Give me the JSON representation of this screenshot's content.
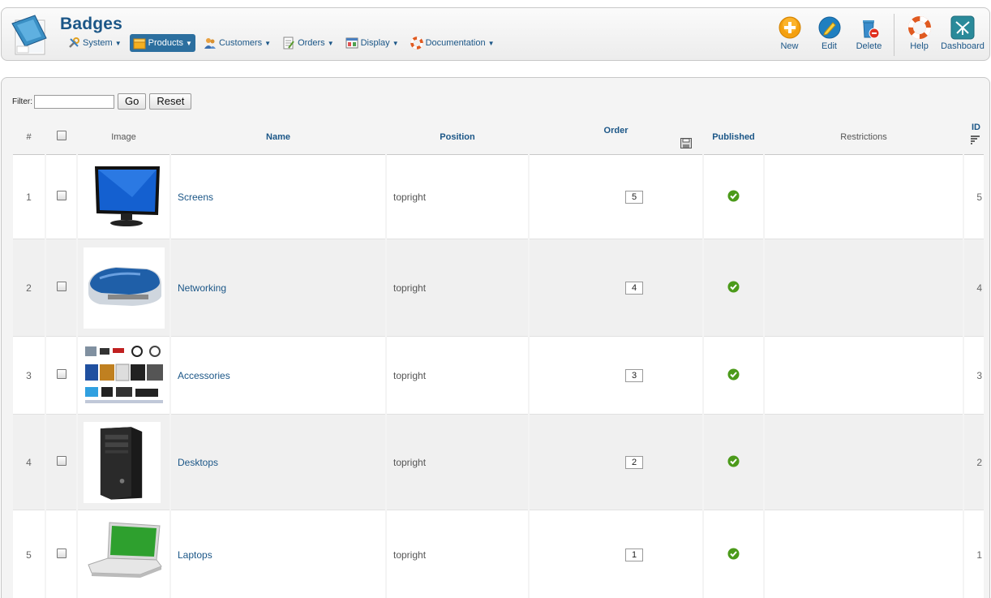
{
  "header": {
    "title": "Badges",
    "menu": [
      {
        "label": "System",
        "icon": "tools-icon"
      },
      {
        "label": "Products",
        "icon": "box-icon",
        "active": true
      },
      {
        "label": "Customers",
        "icon": "users-icon"
      },
      {
        "label": "Orders",
        "icon": "orders-icon"
      },
      {
        "label": "Display",
        "icon": "display-icon"
      },
      {
        "label": "Documentation",
        "icon": "lifebuoy-icon"
      }
    ],
    "toolbar": {
      "new": "New",
      "edit": "Edit",
      "delete": "Delete",
      "help": "Help",
      "dashboard": "Dashboard"
    }
  },
  "filter": {
    "label": "Filter:",
    "value": "",
    "go": "Go",
    "reset": "Reset"
  },
  "table": {
    "columns": {
      "num": "#",
      "image": "Image",
      "name": "Name",
      "position": "Position",
      "order": "Order",
      "published": "Published",
      "restrictions": "Restrictions",
      "id": "ID"
    },
    "rows": [
      {
        "num": "1",
        "name": "Screens",
        "position": "topright",
        "order": "5",
        "id": "5",
        "image": "monitor"
      },
      {
        "num": "2",
        "name": "Networking",
        "position": "topright",
        "order": "4",
        "id": "4",
        "image": "router"
      },
      {
        "num": "3",
        "name": "Accessories",
        "position": "topright",
        "order": "3",
        "id": "3",
        "image": "accessories"
      },
      {
        "num": "4",
        "name": "Desktops",
        "position": "topright",
        "order": "2",
        "id": "2",
        "image": "tower"
      },
      {
        "num": "5",
        "name": "Laptops",
        "position": "topright",
        "order": "1",
        "id": "1",
        "image": "laptop"
      }
    ]
  },
  "colors": {
    "link": "#1b5687",
    "published": "#4b9a1a",
    "active_menu": "#2c6f9f"
  }
}
